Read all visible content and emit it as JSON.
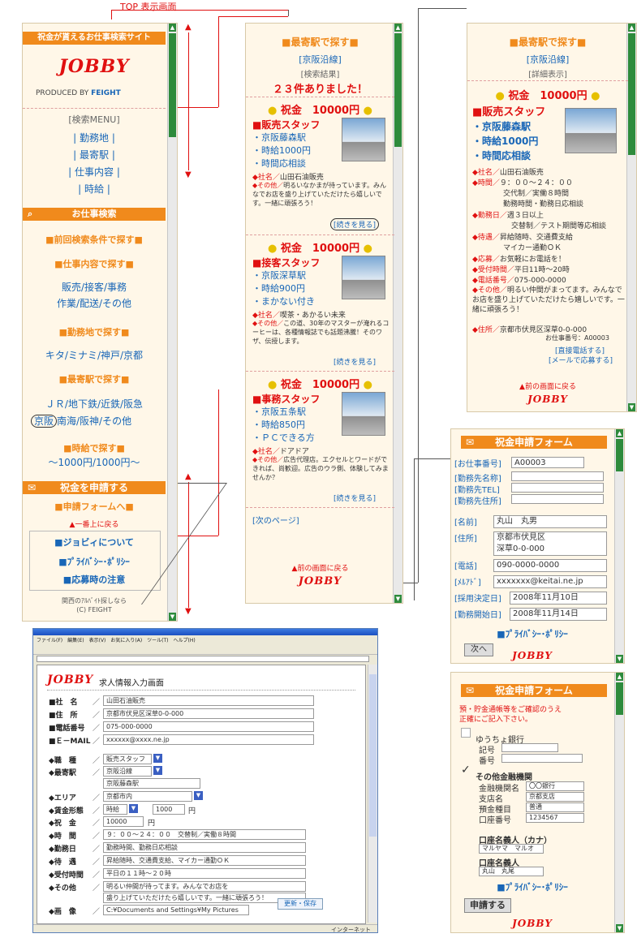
{
  "top_label": "TOP 表示画面",
  "panel1": {
    "site_banner": "祝金が貰えるお仕事検索サイト",
    "logo": "JOBBY",
    "produced_by": "PRODUCED BY",
    "brand": "FEIGHT",
    "menu_title": "[検索MENU]",
    "menu_items": [
      "| 勤務地 |",
      "| 最寄駅 |",
      "| 仕事内容 |",
      "| 時給 |"
    ],
    "search_bar": "お仕事検索",
    "prev_search": "■前回検索条件で探す■",
    "by_job": "■仕事内容で探す■",
    "job_links": [
      "販売/接客/事務",
      "作業/配送/その他"
    ],
    "by_area": "■勤務地で探す■",
    "area_links": "キタ/ミナミ/神戸/京都",
    "by_station": "■最寄駅で探す■",
    "station_links_1": "ＪＲ/地下鉄/近鉄/阪急",
    "station_circle": "京阪",
    "station_links_2": "南海/阪神/その他",
    "by_wage": "■時給で探す■",
    "wage_links": "〜1000円/1000円〜",
    "apply_bar": "祝金を申請する",
    "apply_form": "■申請フォームへ■",
    "to_top": "▲一番上に戻る",
    "about": "■ジョビィについて",
    "privacy": "■ﾌﾟﾗｲﾊﾞｼｰ･ﾎﾟﾘｼｰ",
    "notes": "■応募時の注意",
    "footer_1": "関西のｱﾙﾊﾞｲﾄ探しなら",
    "footer_2": "(C) FEIGHT"
  },
  "panel2": {
    "title": "■最寄駅で探す■",
    "line": "[京阪沿線]",
    "result_label": "[検索結果]",
    "result_count": "２３件ありました！",
    "cards": [
      {
        "bonus": "祝金　10000円",
        "job": "■販売スタッフ",
        "station": "・京阪藤森駅",
        "wage": "・時給1000円",
        "extra": "・時間応相談",
        "company_label": "◆社名／",
        "company": "山田石油販売",
        "other_label": "◆その他／",
        "other": "明るいなかまが待っています。みんなでお店を盛り上げていただけたら嬉しいです。一緒に頑張ろう！",
        "more": "[続きを見る]"
      },
      {
        "bonus": "祝金　10000円",
        "job": "■接客スタッフ",
        "station": "・京阪深草駅",
        "wage": "・時給900円",
        "extra": "・まかない付き",
        "company_label": "◆社名／",
        "company": "喫茶・あかるい未来",
        "other_label": "◆その他／",
        "other": "この道、30年のマスターが淹れるコーヒーは、各種情報誌でも話題沸騰！そのワザ、伝授します。",
        "more": "[続きを見る]"
      },
      {
        "bonus": "祝金　10000円",
        "job": "■事務スタッフ",
        "station": "・京阪五条駅",
        "wage": "・時給850円",
        "extra": "・ＰＣできる方",
        "company_label": "◆社名／",
        "company": "ドアドア",
        "other_label": "◆その他／",
        "other": "広告代理店。エクセルとワードができれば、尚歓迎。広告のウラ側、体験してみませんか？",
        "more": "[続きを見る]"
      }
    ],
    "next_page": "[次のページ]",
    "back": "▲前の画面に戻る",
    "logo": "JOBBY"
  },
  "panel3": {
    "title": "■最寄駅で探す■",
    "line": "[京阪沿線]",
    "detail_label": "[詳細表示]",
    "bonus": "祝金　10000円",
    "job": "■販売スタッフ",
    "station": "・京阪藤森駅",
    "wage": "・時給1000円",
    "extra": "・時間応相談",
    "rows": [
      {
        "label": "◆社名／",
        "value": "山田石油販売"
      },
      {
        "label": "◆時間／",
        "value": "９：００〜２４：００"
      },
      {
        "label": "",
        "value": "交代制／実働８時間"
      },
      {
        "label": "",
        "value": "勤務時間・勤務日応相談"
      },
      {
        "label": "◆勤務日／",
        "value": "週３日以上"
      },
      {
        "label": "",
        "value": "交替制／テスト期間等応相談"
      },
      {
        "label": "◆待遇／",
        "value": "昇給随時、交通費支給"
      },
      {
        "label": "",
        "value": "マイカー通勤ＯＫ"
      },
      {
        "label": "◆応募／",
        "value": "お気軽にお電話を！"
      },
      {
        "label": "◆受付時間／",
        "value": "平日11時〜20時"
      },
      {
        "label": "◆電話番号／",
        "value": "075-000-0000"
      },
      {
        "label": "◆その他／",
        "value": "明るい仲間がまってます。みんなでお店を盛り上げていただけたら嬉しいです。一緒に頑張ろう！"
      },
      {
        "label": "◆住所／",
        "value": "京都市伏見区深草0-0-000"
      }
    ],
    "job_no": "お仕事番号：A00003",
    "call": "[直接電話する]",
    "mail": "[メールで応募する]",
    "back": "▲前の画面に戻る",
    "logo": "JOBBY"
  },
  "panel4": {
    "bar": "祝金申請フォーム",
    "fields": [
      {
        "label": "[お仕事番号]",
        "value": "A00003"
      },
      {
        "label": "[勤務先名称]",
        "value": ""
      },
      {
        "label": "[勤務先TEL]",
        "value": ""
      },
      {
        "label": "[勤務先住所]",
        "value": ""
      },
      {
        "label": "[名前]",
        "value": "丸山　丸男"
      },
      {
        "label": "[住所]",
        "value": "京都市伏見区"
      },
      {
        "label": "",
        "value": "深草0-0-000"
      },
      {
        "label": "[電話]",
        "value": "090-0000-0000"
      },
      {
        "label": "[ﾒﾙｱﾄﾞ]",
        "value": "xxxxxxx@keitai.ne.jp"
      },
      {
        "label": "[採用決定日]",
        "value": "2008年11月10日"
      },
      {
        "label": "[勤務開始日]",
        "value": "2008年11月14日"
      }
    ],
    "privacy": "■ﾌﾟﾗｲﾊﾞｼｰ･ﾎﾟﾘｼｰ",
    "next": "次へ",
    "logo": "JOBBY"
  },
  "panel5": {
    "bar": "祝金申請フォーム",
    "instruction_1": "預・貯金通帳等をご確認のうえ",
    "instruction_2": "正確にご記入下さい。",
    "yucho": "ゆうちょ銀行",
    "kigo": "記号",
    "bango": "番号",
    "other_bank": "その他金融機関",
    "bank_rows": [
      {
        "label": "金融機関名",
        "value": "〇〇銀行"
      },
      {
        "label": "支店名",
        "value": "京都支店"
      },
      {
        "label": "預金種目",
        "value": "普通"
      },
      {
        "label": "口座番号",
        "value": "1234567"
      }
    ],
    "holder_kana": "口座名義人（カナ）",
    "holder_kana_value": "マルヤマ　マルオ",
    "holder": "口座名義人",
    "holder_value": "丸山　丸尾",
    "privacy": "■ﾌﾟﾗｲﾊﾞｼｰ･ﾎﾟﾘｼｰ",
    "submit": "申請する",
    "logo": "JOBBY"
  },
  "admin": {
    "menu": "ファイル(F)　編集(E)　表示(V)　お気に入り(A)　ツール(T)　ヘルプ(H)",
    "logo": "JOBBY",
    "title": "求人情報入力画面",
    "rows": [
      {
        "label": "■社　名",
        "value": "山田石油販売"
      },
      {
        "label": "■住　所",
        "value": "京都市伏見区深草0-0-000"
      },
      {
        "label": "■電話番号",
        "value": "075-000-0000"
      },
      {
        "label": "■Ｅ－MAIL",
        "value": "xxxxxx@xxxx.ne.jp"
      },
      {
        "label": "◆職　種",
        "value": "販売スタッフ"
      },
      {
        "label": "◆最寄駅",
        "value": "京阪沿線"
      },
      {
        "label": "",
        "value": "京阪藤森駅"
      },
      {
        "label": "◆エリア",
        "value": "京都市内"
      },
      {
        "label": "◆賃金形態",
        "value": "時給"
      },
      {
        "label": "◆祝　金",
        "value": "10000"
      },
      {
        "label": "◆時　間",
        "value": "９：００〜２４：００　交替制／実働８時間"
      },
      {
        "label": "◆勤務日",
        "value": "勤務時間、勤務日応相談"
      },
      {
        "label": "◆待　遇",
        "value": "昇給随時、交通費支給、マイカー通勤ＯＫ"
      },
      {
        "label": "◆受付時間",
        "value": "平日の１１時〜２０時"
      },
      {
        "label": "◆その他",
        "value": "明るい仲間が待ってます。みんなでお店を"
      },
      {
        "label": "",
        "value": "盛り上げていただけたら嬉しいです。一緒に頑張ろう！"
      },
      {
        "label": "◆画　像",
        "value": "C:¥Documents and Settings¥My Pictures"
      }
    ],
    "wage_amount": "1000",
    "yen": "円",
    "save": "更新・保存",
    "status": "インターネット"
  }
}
